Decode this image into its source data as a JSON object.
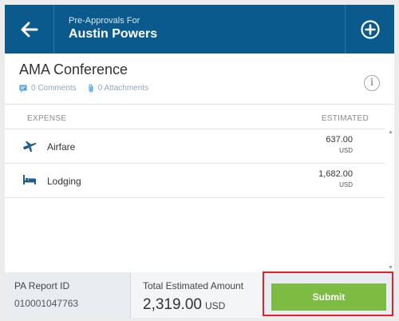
{
  "header": {
    "subtitle": "Pre-Approvals For",
    "title": "Austin Powers",
    "back_icon": "arrow-left-icon",
    "add_icon": "plus-circle-icon",
    "color": "#0a5a8e"
  },
  "report": {
    "title": "AMA Conference",
    "comments": "0 Comments",
    "attachments": "0 Attachments",
    "info_icon": "i"
  },
  "table": {
    "col_expense": "EXPENSE",
    "col_estimated": "ESTIMATED",
    "rows": [
      {
        "icon": "airplane-icon",
        "label": "Airfare",
        "amount": "637.00",
        "currency": "USD"
      },
      {
        "icon": "bed-icon",
        "label": "Lodging",
        "amount": "1,682.00",
        "currency": "USD"
      }
    ]
  },
  "footer": {
    "report_id_label": "PA Report ID",
    "report_id": "010001047763",
    "total_label": "Total Estimated Amount",
    "total": "2,319.00",
    "total_currency": "USD",
    "submit_label": "Submit",
    "submit_color": "#7dbb42",
    "highlight_color": "#e8202a"
  }
}
